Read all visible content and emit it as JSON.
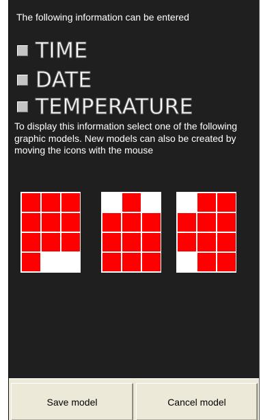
{
  "intro_text": "The following information can be entered",
  "options": [
    {
      "label": "TIME",
      "checked": false
    },
    {
      "label": "DATE",
      "checked": false
    },
    {
      "label": "TEMPERATURE",
      "checked": false
    }
  ],
  "description": "To display this information select one of the following graphic models. New models can also be created by moving the icons with the mouse",
  "models": [
    {
      "rows": [
        "111",
        "111",
        "111",
        "100"
      ]
    },
    {
      "rows": [
        "010",
        "111",
        "111",
        "111"
      ]
    },
    {
      "rows": [
        "011",
        "111",
        "111",
        "011"
      ]
    }
  ],
  "colors": {
    "panel_bg": "#1f1f1f",
    "cell_on": "#ff0000",
    "cell_off": "#ffffff",
    "button_bg": "#ece9d8"
  },
  "buttons": {
    "save": "Save model",
    "cancel": "Cancel model"
  }
}
